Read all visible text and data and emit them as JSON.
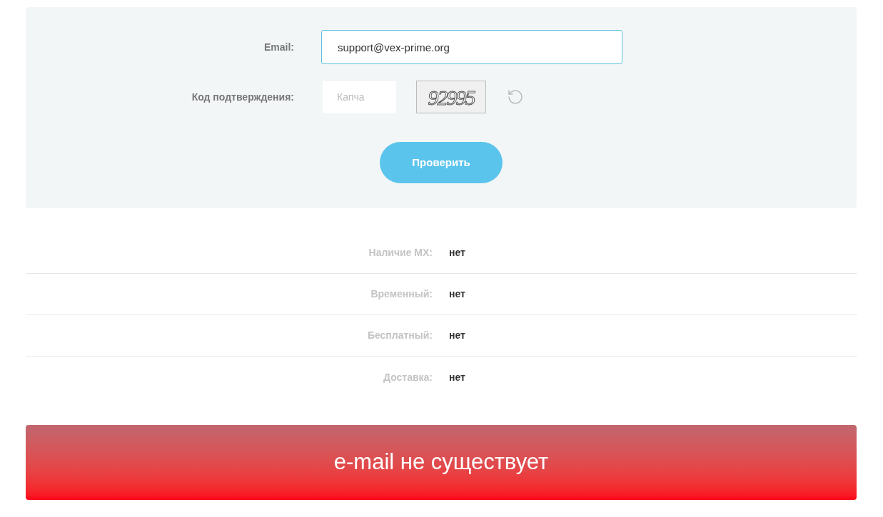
{
  "form": {
    "email": {
      "label": "Email:",
      "value": "support@vex-prime.org"
    },
    "captcha": {
      "label": "Код подтверждения:",
      "placeholder": "Капча",
      "code": "92995"
    },
    "submit": "Проверить"
  },
  "results": [
    {
      "label": "Наличие MX:",
      "value": "нет"
    },
    {
      "label": "Временный:",
      "value": "нет"
    },
    {
      "label": "Бесплатный:",
      "value": "нет"
    },
    {
      "label": "Доставка:",
      "value": "нет"
    }
  ],
  "verdict": {
    "text": "e-mail не существует",
    "kind": "error"
  }
}
